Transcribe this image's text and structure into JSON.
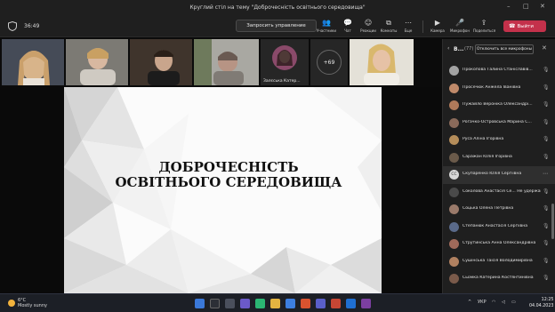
{
  "window": {
    "title": "Круглий стіл на тему \"Доброчесність освітнього середовища\"",
    "controls": [
      "–",
      "□",
      "✕"
    ]
  },
  "toolbar": {
    "timer": "36:49",
    "request_control": "Запросить управление",
    "buttons": [
      {
        "label": "Участники",
        "icon": "people-icon",
        "glyph": "👥"
      },
      {
        "label": "Чат",
        "icon": "chat-icon",
        "glyph": "💬"
      },
      {
        "label": "Реакции",
        "icon": "reactions-icon",
        "glyph": "☺"
      },
      {
        "label": "Комнаты",
        "icon": "rooms-icon",
        "glyph": "⧉"
      },
      {
        "label": "Еще",
        "icon": "more-icon",
        "glyph": "⋯"
      },
      {
        "label": "Камера",
        "icon": "camera-icon",
        "glyph": "▶"
      },
      {
        "label": "Микрофон",
        "icon": "microphone-icon",
        "glyph": "🎤"
      },
      {
        "label": "Поделиться",
        "icon": "share-icon",
        "glyph": "⇪"
      }
    ],
    "leave": "Выйти"
  },
  "video_strip": {
    "tiles": [
      {
        "name": ""
      },
      {
        "name": ""
      },
      {
        "name": ""
      },
      {
        "name": ""
      },
      {
        "name": "Залєська Катер...",
        "avatar": true
      },
      {
        "name": "",
        "overflow": "+69"
      },
      {
        "name": ""
      }
    ]
  },
  "slide": {
    "title_line1": "ДОБРОЧЕСНІСТЬ",
    "title_line2": "ОСВІТНЬОГО СЕРЕДОВИЩА"
  },
  "participants_panel": {
    "heading": "В...",
    "count": "(77)",
    "mute_all": "Отключить все микрофоны",
    "close": "✕",
    "people": [
      {
        "name": "Прокопова Галина Станіславів...",
        "color": "#a3a3a3"
      },
      {
        "name": "Просечюк Анжела Іванівна",
        "color": "#c08a6a"
      },
      {
        "name": "Пужайло Вероніка Олександрі...",
        "color": "#b07a5a"
      },
      {
        "name": "Рогачко-Островська Марина С...",
        "color": "#8a6a5a"
      },
      {
        "name": "Руса Аліна Ігорівна",
        "color": "#b58d5a"
      },
      {
        "name": "Саражан Юлія Ігорівна",
        "color": "#6a5a4a"
      },
      {
        "name": "Скупаренко Юлія Сергіївна",
        "initials": "СС",
        "color": "#d7d7d7"
      },
      {
        "name": "Соколова Анастасія Се... Не удержаним",
        "color": "#4a4a4a"
      },
      {
        "name": "Соцька Олена Петрівна",
        "color": "#9a7a6a"
      },
      {
        "name": "Степанюк Анастасія Сергіївна",
        "color": "#5a6a8a"
      },
      {
        "name": "Струтинська Анна Олександрівна",
        "color": "#a06a5a"
      },
      {
        "name": "Сушінська Таїсія Володимирівна",
        "color": "#b08060"
      },
      {
        "name": "Сьомка Катерина Костянтинівна",
        "color": "#7a5a4a"
      }
    ]
  },
  "taskbar": {
    "weather_temp": "6°C",
    "weather_text": "Mostly sunny",
    "lang": "УКР",
    "time": "12:25",
    "date": "04.04.2023"
  }
}
